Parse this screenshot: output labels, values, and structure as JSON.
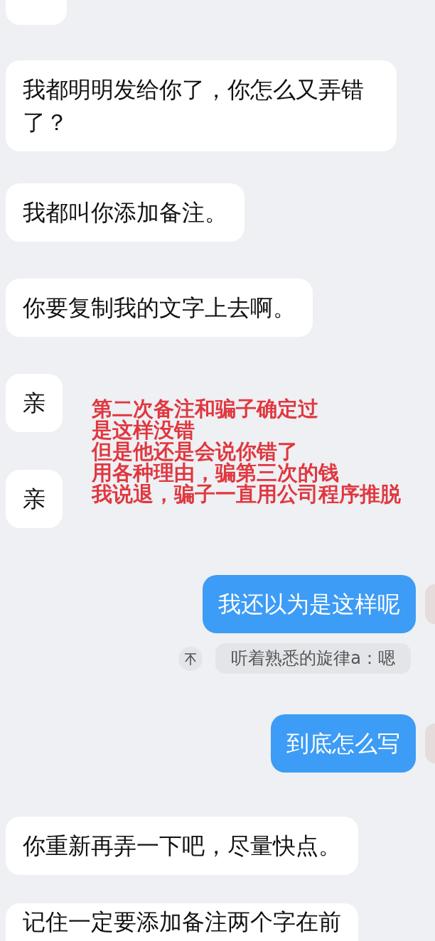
{
  "messages": [
    {
      "kind": "received_cut"
    },
    {
      "kind": "received",
      "text": "我都明明发给你了，你怎么又弄错了？"
    },
    {
      "kind": "received",
      "text": "我都叫你添加备注。"
    },
    {
      "kind": "received",
      "text": "你要复制我的文字上去啊。"
    },
    {
      "kind": "annotated",
      "texts": [
        "亲",
        "亲"
      ],
      "annotation": [
        "第二次备注和骗子确定过",
        "是这样没错",
        "但是他还是会说你错了",
        "用各种理由，骗第三次的钱",
        "我说退，骗子一直用公司程序推脱"
      ]
    },
    {
      "kind": "sent",
      "text": "我还以为是这样呢"
    },
    {
      "kind": "quote",
      "text": "听着熟悉的旋律a：嗯"
    },
    {
      "kind": "sent",
      "text": "到底怎么写"
    },
    {
      "kind": "received",
      "text": "你重新再弄一下吧，尽量快点。"
    },
    {
      "kind": "received_bottom",
      "text": "记住一定要添加备注两个字在前"
    }
  ]
}
